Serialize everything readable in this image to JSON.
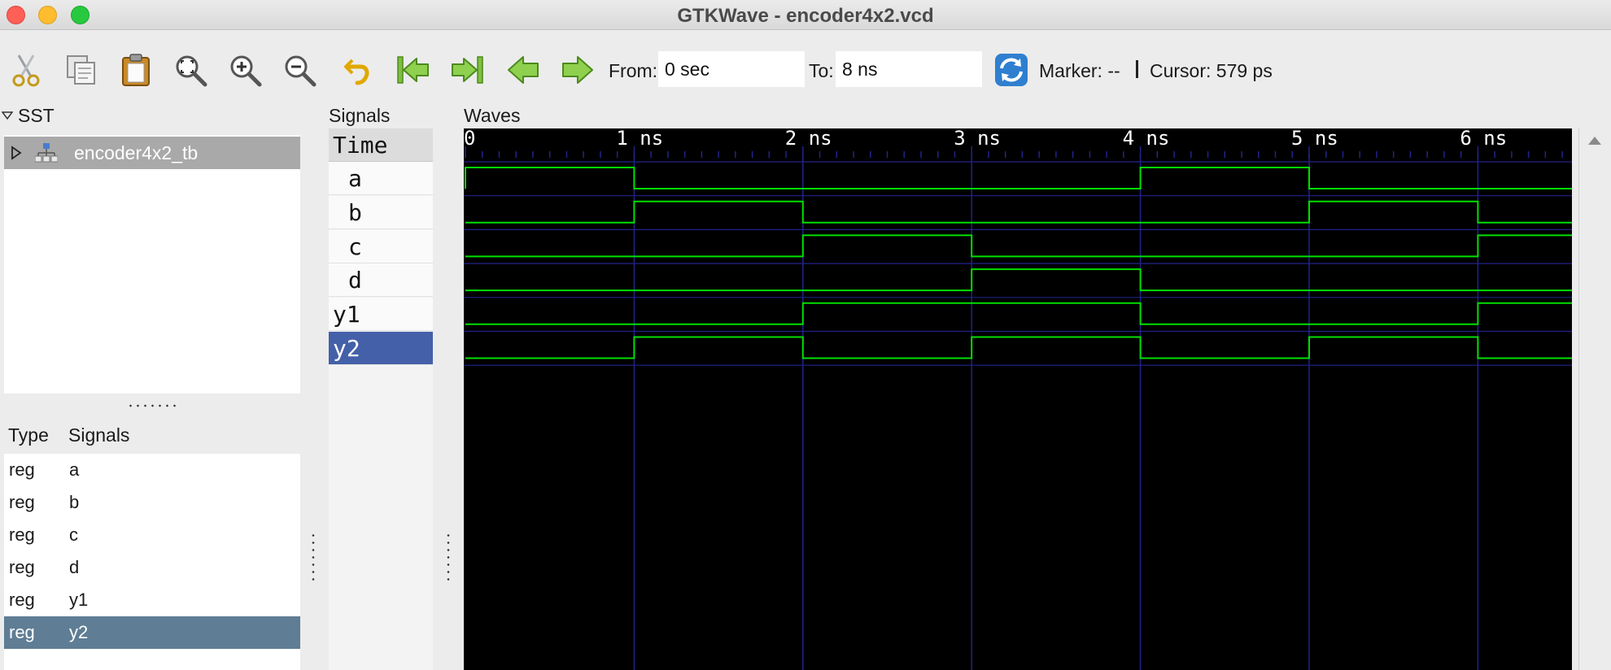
{
  "window": {
    "title": "GTKWave - encoder4x2.vcd"
  },
  "toolbar": {
    "buttons": [
      {
        "icon": "cut-icon",
        "tooltip": "Cut"
      },
      {
        "icon": "copy-icon",
        "tooltip": "Copy"
      },
      {
        "icon": "paste-icon",
        "tooltip": "Paste"
      },
      {
        "icon": "zoom-fit-icon",
        "tooltip": "Zoom Fit"
      },
      {
        "icon": "zoom-in-icon",
        "tooltip": "Zoom In"
      },
      {
        "icon": "zoom-out-icon",
        "tooltip": "Zoom Out"
      },
      {
        "icon": "undo-zoom-icon",
        "tooltip": "Undo Zoom"
      },
      {
        "icon": "zoom-start-icon",
        "tooltip": "Zoom to Start"
      },
      {
        "icon": "zoom-end-icon",
        "tooltip": "Zoom to End"
      },
      {
        "icon": "prev-edge-icon",
        "tooltip": "Find Previous Edge"
      },
      {
        "icon": "next-edge-icon",
        "tooltip": "Find Next Edge"
      },
      {
        "icon": "reload-icon",
        "tooltip": "Reload"
      }
    ],
    "from_label": "From:",
    "from_value": "0 sec",
    "to_label": "To:",
    "to_value": "8 ns",
    "marker_label": "Marker: --",
    "cursor_label": "Cursor: 579 ps"
  },
  "sst": {
    "label": "SST",
    "tree": [
      {
        "name": "encoder4x2_tb",
        "expanded": false
      }
    ]
  },
  "signal_list": {
    "type_header": "Type",
    "signals_header": "Signals",
    "rows": [
      {
        "type": "reg",
        "name": "a"
      },
      {
        "type": "reg",
        "name": "b"
      },
      {
        "type": "reg",
        "name": "c"
      },
      {
        "type": "reg",
        "name": "d"
      },
      {
        "type": "reg",
        "name": "y1"
      },
      {
        "type": "reg",
        "name": "y2",
        "selected": true
      }
    ]
  },
  "signals_pane": {
    "label": "Signals",
    "time_label": "Time",
    "names": [
      "a",
      "b",
      "c",
      "d",
      "y1",
      "y2"
    ],
    "selected": "y2"
  },
  "waves_pane": {
    "label": "Waves",
    "colors": {
      "background": "#000000",
      "trace": "#00e000",
      "gridline": "#23238c",
      "ruler_text": "#ffffff"
    }
  },
  "chart_data": {
    "type": "line",
    "x_unit": "ns",
    "xlim": [
      0,
      6.58
    ],
    "tick_labels": [
      "0",
      "1 ns",
      "2 ns",
      "3 ns",
      "4 ns",
      "5 ns",
      "6 ns"
    ],
    "tick_values": [
      0,
      1,
      2,
      3,
      4,
      5,
      6
    ],
    "minor_ticks_per_ns": 10,
    "series": [
      {
        "name": "a",
        "values": [
          [
            0,
            1
          ],
          [
            1,
            0
          ],
          [
            4,
            1
          ],
          [
            5,
            0
          ]
        ]
      },
      {
        "name": "b",
        "values": [
          [
            0,
            0
          ],
          [
            1,
            1
          ],
          [
            2,
            0
          ],
          [
            5,
            1
          ],
          [
            6,
            0
          ]
        ]
      },
      {
        "name": "c",
        "values": [
          [
            0,
            0
          ],
          [
            2,
            1
          ],
          [
            3,
            0
          ],
          [
            6,
            1
          ]
        ]
      },
      {
        "name": "d",
        "values": [
          [
            0,
            0
          ],
          [
            3,
            1
          ],
          [
            4,
            0
          ]
        ]
      },
      {
        "name": "y1",
        "values": [
          [
            0,
            0
          ],
          [
            2,
            1
          ],
          [
            4,
            0
          ],
          [
            6,
            1
          ]
        ]
      },
      {
        "name": "y2",
        "values": [
          [
            0,
            0
          ],
          [
            1,
            1
          ],
          [
            2,
            0
          ],
          [
            3,
            1
          ],
          [
            4,
            0
          ],
          [
            5,
            1
          ],
          [
            6,
            0
          ]
        ]
      }
    ]
  }
}
